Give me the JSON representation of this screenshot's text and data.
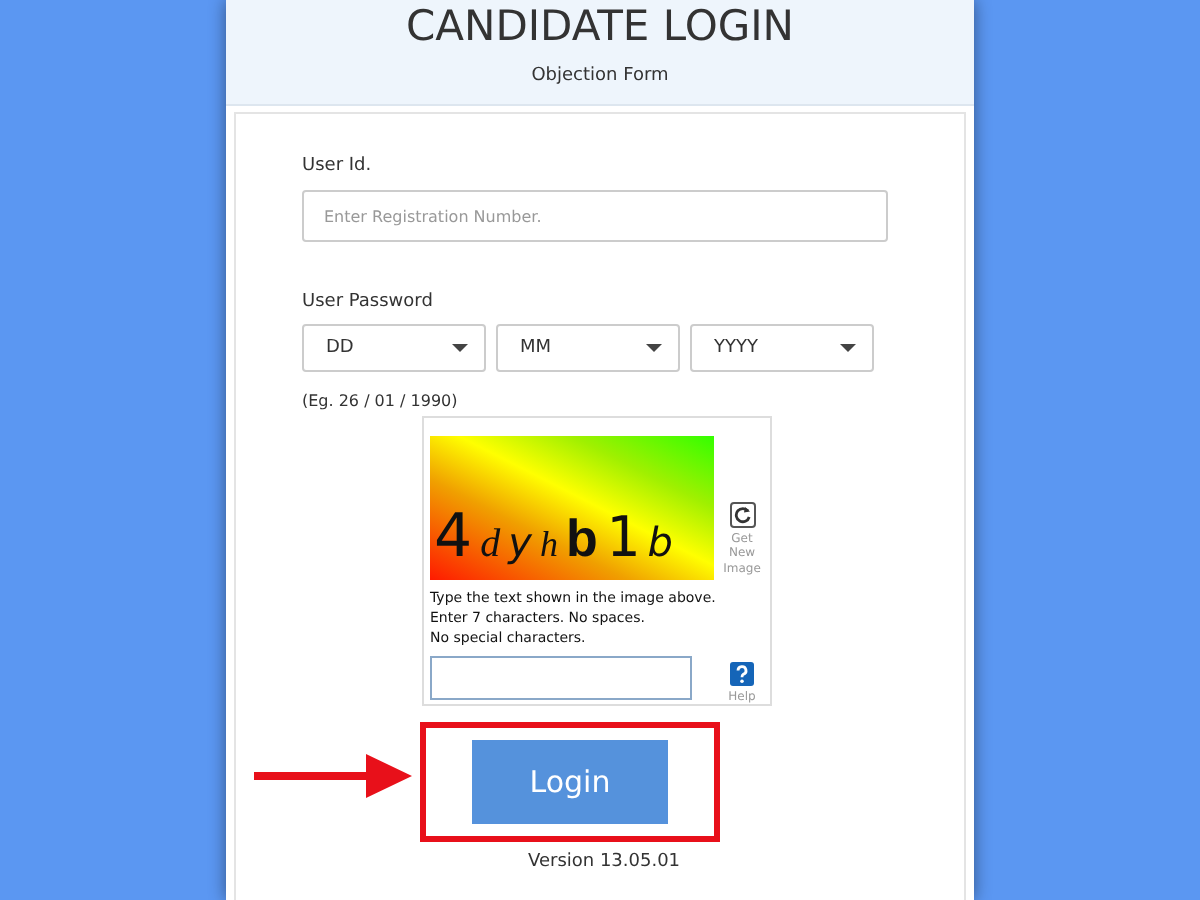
{
  "header": {
    "title": "CANDIDATE LOGIN",
    "subtitle": "Objection Form"
  },
  "user_id": {
    "label": "User Id.",
    "placeholder": "Enter Registration Number."
  },
  "password": {
    "label": "User Password",
    "selects": [
      "DD",
      "MM",
      "YYYY"
    ],
    "hint": "(Eg. 26 / 01 / 1990)"
  },
  "captcha": {
    "text": "4dyhb1b",
    "refresh_label": "Get New Image",
    "instructions": [
      "Type the text shown in the image above.",
      "Enter 7 characters. No spaces.",
      "No special characters."
    ],
    "help_label": "Help"
  },
  "login_button": {
    "label": "Login",
    "highlighted": true
  },
  "version": "Version 13.05.01"
}
